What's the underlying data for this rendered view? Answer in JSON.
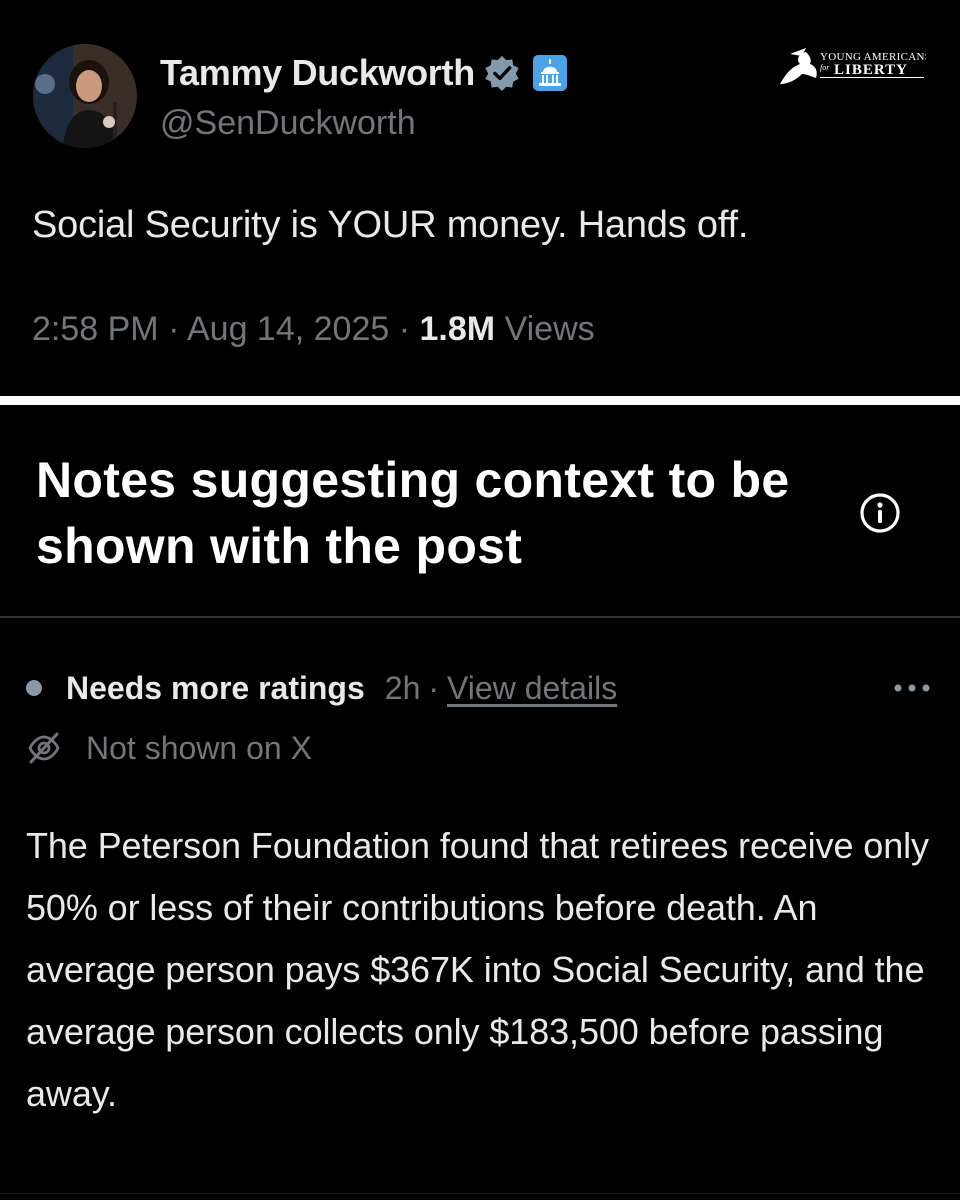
{
  "tweet": {
    "author": {
      "display_name": "Tammy Duckworth",
      "handle": "@SenDuckworth",
      "verified": true,
      "badge_icon": "verified-badge-icon",
      "affiliation_icon": "capitol-building-icon"
    },
    "text": "Social Security is YOUR money. Hands off.",
    "time": "2:58 PM",
    "date": "Aug 14, 2025",
    "separator": "·",
    "views_count": "1.8M",
    "views_label": "Views"
  },
  "watermark": {
    "name": "Young Americans for Liberty",
    "icon": "eagle-logo-icon"
  },
  "notes": {
    "title": "Notes suggesting context to be shown with the post",
    "info_icon": "info-icon",
    "note": {
      "status": "Needs more ratings",
      "age": "2h",
      "separator": "·",
      "view_details_label": "View details",
      "visibility": "Not shown on X",
      "visibility_icon": "eye-off-icon",
      "more_icon": "more-options-icon",
      "body": "The Peterson Foundation found that retirees receive only 50% or less of their contributions before death. An average person pays $367K into Social Security, and the average person collects only $183,500 before passing away."
    }
  },
  "colors": {
    "background": "#000000",
    "text_primary": "#e7e9ea",
    "text_secondary": "#71767b",
    "verified_badge": "#829aab",
    "divider": "#2f3336"
  }
}
